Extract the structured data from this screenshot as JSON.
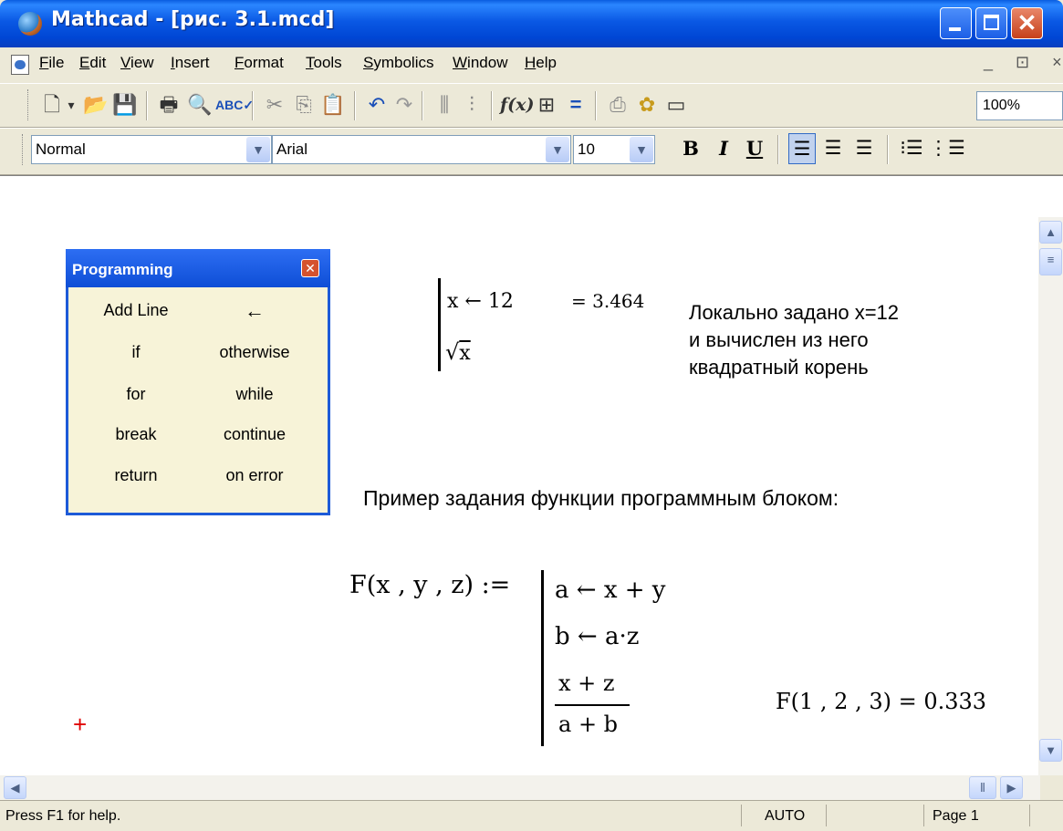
{
  "window": {
    "title": "Mathcad - [рис. 3.1.mcd]"
  },
  "menu": [
    "File",
    "Edit",
    "View",
    "Insert",
    "Format",
    "Tools",
    "Symbolics",
    "Window",
    "Help"
  ],
  "menu_right": "_ ⊡ ×",
  "toolbar": {
    "zoom": "100%"
  },
  "format_bar": {
    "style": "Normal",
    "font": "Arial",
    "size": "10",
    "bold": "B",
    "italic": "I",
    "underline": "U"
  },
  "palette": {
    "title": "Programming",
    "buttons": [
      [
        "Add Line",
        "←"
      ],
      [
        "if",
        "otherwise"
      ],
      [
        "for",
        "while"
      ],
      [
        "break",
        "continue"
      ],
      [
        "return",
        "on error"
      ]
    ]
  },
  "block1": {
    "line1": "x ← 12",
    "line2_arg": "x",
    "result": "= 3.464",
    "note": [
      "Локально задано x=12",
      "и вычислен из него",
      "квадратный корень"
    ]
  },
  "caption": "Пример задания функции программным блоком:",
  "block2": {
    "def": "F(x , y , z) :=",
    "line1": "a ← x + y",
    "line2": "b ← a·z",
    "num": "x + z",
    "den": "a + b",
    "eval": "F(1 , 2 , 3) = 0.333"
  },
  "status": {
    "help": "Press F1 for help.",
    "mode": "AUTO",
    "page": "Page 1"
  }
}
